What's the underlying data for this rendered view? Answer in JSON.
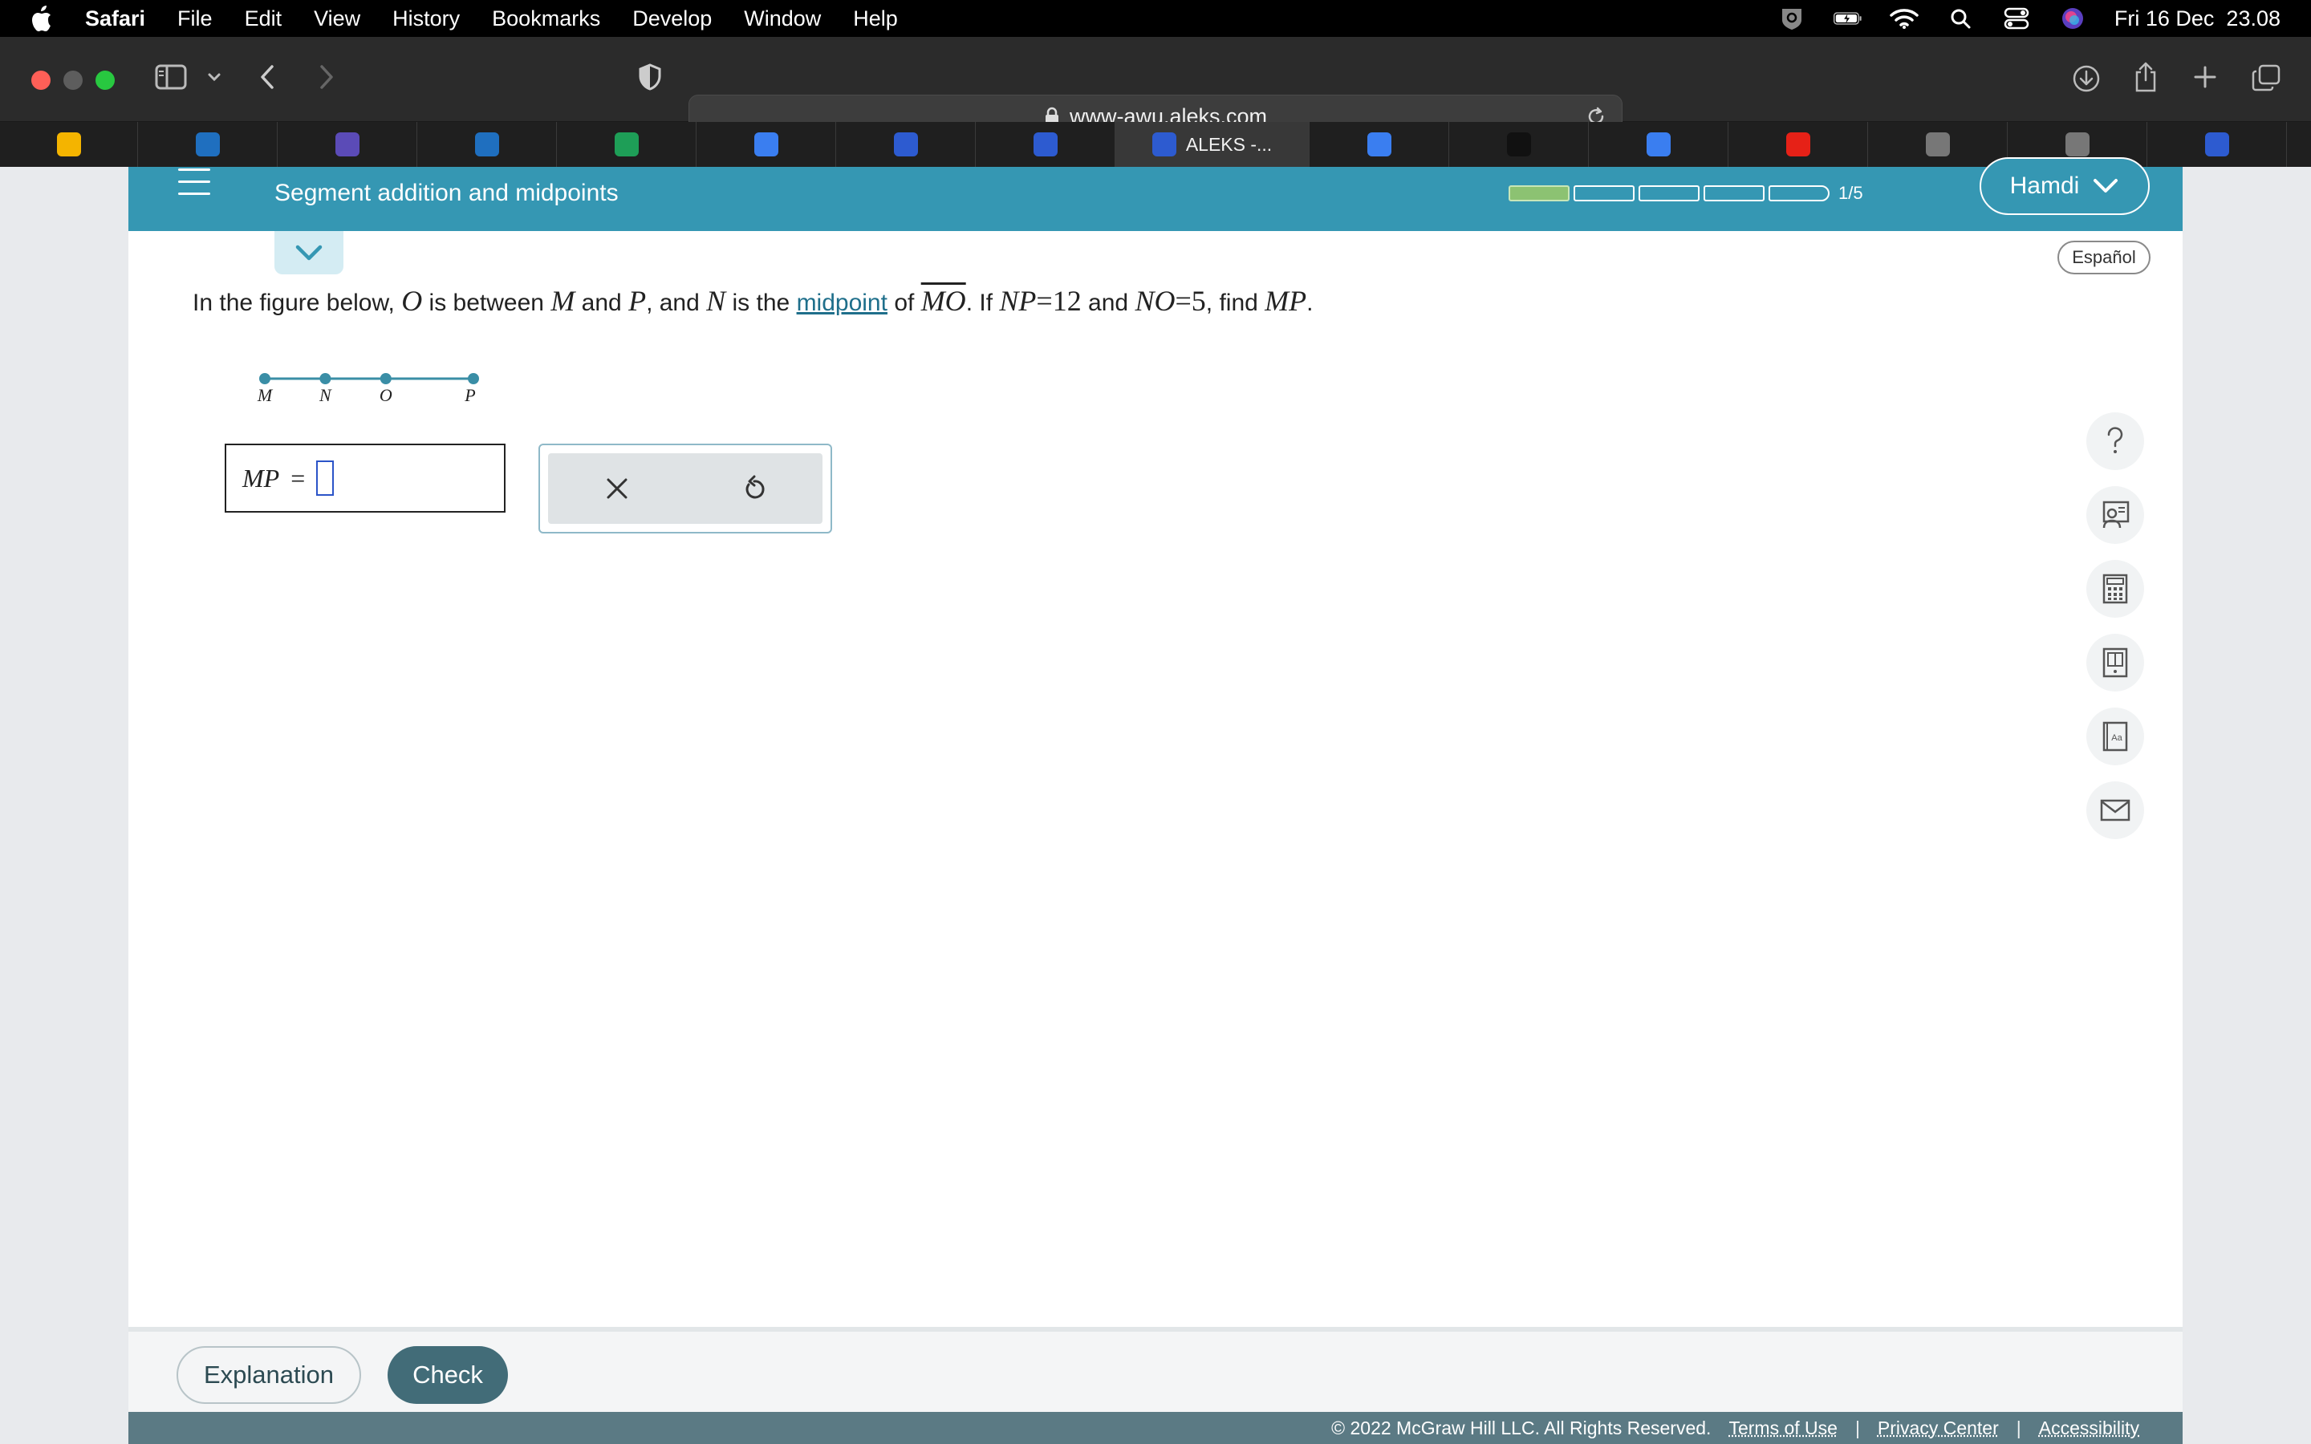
{
  "menubar": {
    "app": "Safari",
    "items": [
      "File",
      "Edit",
      "View",
      "History",
      "Bookmarks",
      "Develop",
      "Window",
      "Help"
    ],
    "datetime": "Fri 16 Dec  23.08"
  },
  "browser": {
    "url": "www-awu.aleks.com",
    "tabs": [
      {
        "icon": "google-drive-icon",
        "label": "",
        "color": "#f4b400"
      },
      {
        "icon": "schoology-icon",
        "label": "",
        "color": "#1f6fbf"
      },
      {
        "icon": "app-icon",
        "label": "",
        "color": "#5b4bb7"
      },
      {
        "icon": "schoology-icon",
        "label": "",
        "color": "#1f6fbf"
      },
      {
        "icon": "google-sheets-icon",
        "label": "",
        "color": "#1e9e57"
      },
      {
        "icon": "google-docs-icon",
        "label": "",
        "color": "#3a7ef0"
      },
      {
        "icon": "app-icon",
        "label": "",
        "color": "#2d5bd0"
      },
      {
        "icon": "aleks-icon",
        "label": "",
        "color": "#2d5bd0"
      },
      {
        "icon": "aleks-icon",
        "label": "ALEKS -...",
        "color": "#2d5bd0"
      },
      {
        "icon": "camera-icon",
        "label": "",
        "color": "#3a7ef0"
      },
      {
        "icon": "app-icon",
        "label": "",
        "color": "#111111"
      },
      {
        "icon": "google-docs-icon",
        "label": "",
        "color": "#3a7ef0"
      },
      {
        "icon": "youtube-icon",
        "label": "",
        "color": "#e62117"
      },
      {
        "icon": "app-icon",
        "label": "",
        "color": "#777777"
      },
      {
        "icon": "app-icon",
        "label": "",
        "color": "#777777"
      },
      {
        "icon": "app-icon",
        "label": "",
        "color": "#2d5bd0"
      }
    ]
  },
  "header": {
    "topic": "Segment addition and midpoints",
    "progress": {
      "completed": 1,
      "total": 5,
      "label": "1/5"
    },
    "user": "Hamdi",
    "espanol": "Español"
  },
  "question": {
    "t1": "In the figure below,",
    "O": "O",
    "t2": "is between",
    "M": "M",
    "t3": "and",
    "P": "P",
    "t4": ", and",
    "N": "N",
    "t5": "is the",
    "link": "midpoint",
    "t6": "of",
    "MO": "MO",
    "t7": ". If",
    "NP": "NP",
    "eq": "=",
    "np_val": "12",
    "t8": "and",
    "NO": "NO",
    "no_val": "5",
    "t9": ", find",
    "MP": "MP",
    "t10": "."
  },
  "figure": {
    "points": [
      {
        "label": "M",
        "position": 0
      },
      {
        "label": "N",
        "position": 0.29
      },
      {
        "label": "O",
        "position": 0.58
      },
      {
        "label": "P",
        "position": 1
      }
    ]
  },
  "answer": {
    "label": "MP",
    "eq": "=",
    "value": ""
  },
  "side_tools": [
    "help-icon",
    "tutor-icon",
    "calculator-icon",
    "ebook-icon",
    "dictionary-icon",
    "mail-icon"
  ],
  "buttons": {
    "explanation": "Explanation",
    "check": "Check"
  },
  "footer": {
    "copyright": "© 2022 McGraw Hill LLC. All Rights Reserved.",
    "terms": "Terms of Use",
    "privacy": "Privacy Center",
    "accessibility": "Accessibility",
    "sep": "|"
  }
}
